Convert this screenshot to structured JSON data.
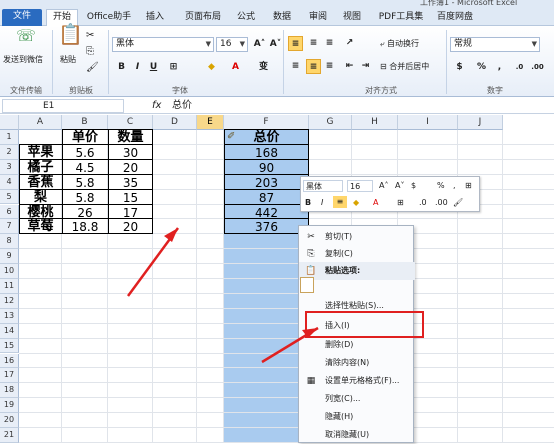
{
  "window": {
    "title": "工作簿1 - Microsoft Excel"
  },
  "tabs": [
    "文件",
    "开始",
    "Office助手",
    "插入",
    "页面布局",
    "公式",
    "数据",
    "审阅",
    "视图",
    "PDF工具集",
    "百度网盘"
  ],
  "ribbon": {
    "wechat": "发送到微信",
    "paste": "粘贴",
    "font_name": "黑体",
    "font_size": "16",
    "wrap": "自动换行",
    "merge": "合并后居中",
    "number_format": "常规",
    "groups": [
      "文件传输",
      "剪贴板",
      "字体",
      "对齐方式",
      "数字"
    ]
  },
  "formula_bar": {
    "name_box": "E1",
    "fx": "fx",
    "content": "总价"
  },
  "columns": [
    "A",
    "B",
    "C",
    "D",
    "E",
    "F",
    "G",
    "H",
    "I",
    "J"
  ],
  "rows": [
    "1",
    "2",
    "3",
    "4",
    "5",
    "6",
    "7",
    "8",
    "9",
    "10",
    "11",
    "12",
    "13",
    "14",
    "15",
    "16",
    "17",
    "18",
    "19",
    "20",
    "21"
  ],
  "table": {
    "headers": [
      "单价",
      "数量",
      "总价"
    ],
    "names": [
      "苹果",
      "橘子",
      "香蕉",
      "梨",
      "樱桃",
      "草莓"
    ],
    "prices": [
      "5.6",
      "4.5",
      "5.8",
      "5.8",
      "26",
      "18.8"
    ],
    "qty": [
      "30",
      "20",
      "35",
      "15",
      "17",
      "20"
    ],
    "totals": [
      "168",
      "90",
      "203",
      "87",
      "442",
      "376"
    ]
  },
  "mini_toolbar": {
    "font": "黑体",
    "size": "16"
  },
  "context_menu": {
    "items": [
      "剪切(T)",
      "复制(C)",
      "粘贴选项:",
      "选择性粘贴(S)...",
      "插入(I)",
      "删除(D)",
      "清除内容(N)",
      "设置单元格格式(F)...",
      "列宽(C)...",
      "隐藏(H)",
      "取消隐藏(U)"
    ]
  },
  "colors": {
    "selection": "#a9cbef",
    "highlight_box": "#e02020",
    "file_tab": "#2a6bc0"
  }
}
